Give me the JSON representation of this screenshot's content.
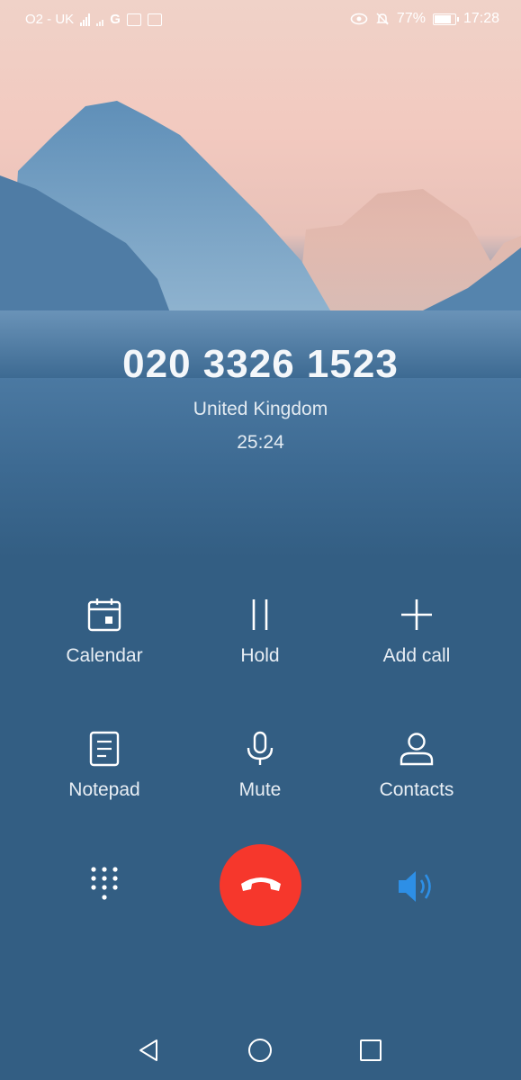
{
  "status_bar": {
    "carrier": "O2 - UK",
    "extra_carrier": "G",
    "battery": "77%",
    "time": "17:28"
  },
  "call": {
    "number": "020 3326 1523",
    "country": "United Kingdom",
    "duration": "25:24"
  },
  "actions": {
    "calendar": "Calendar",
    "hold": "Hold",
    "add_call": "Add call",
    "notepad": "Notepad",
    "mute": "Mute",
    "contacts": "Contacts"
  },
  "colors": {
    "end_call": "#f6372c",
    "speaker_active": "#2d8fe6",
    "background": "#335e83"
  }
}
